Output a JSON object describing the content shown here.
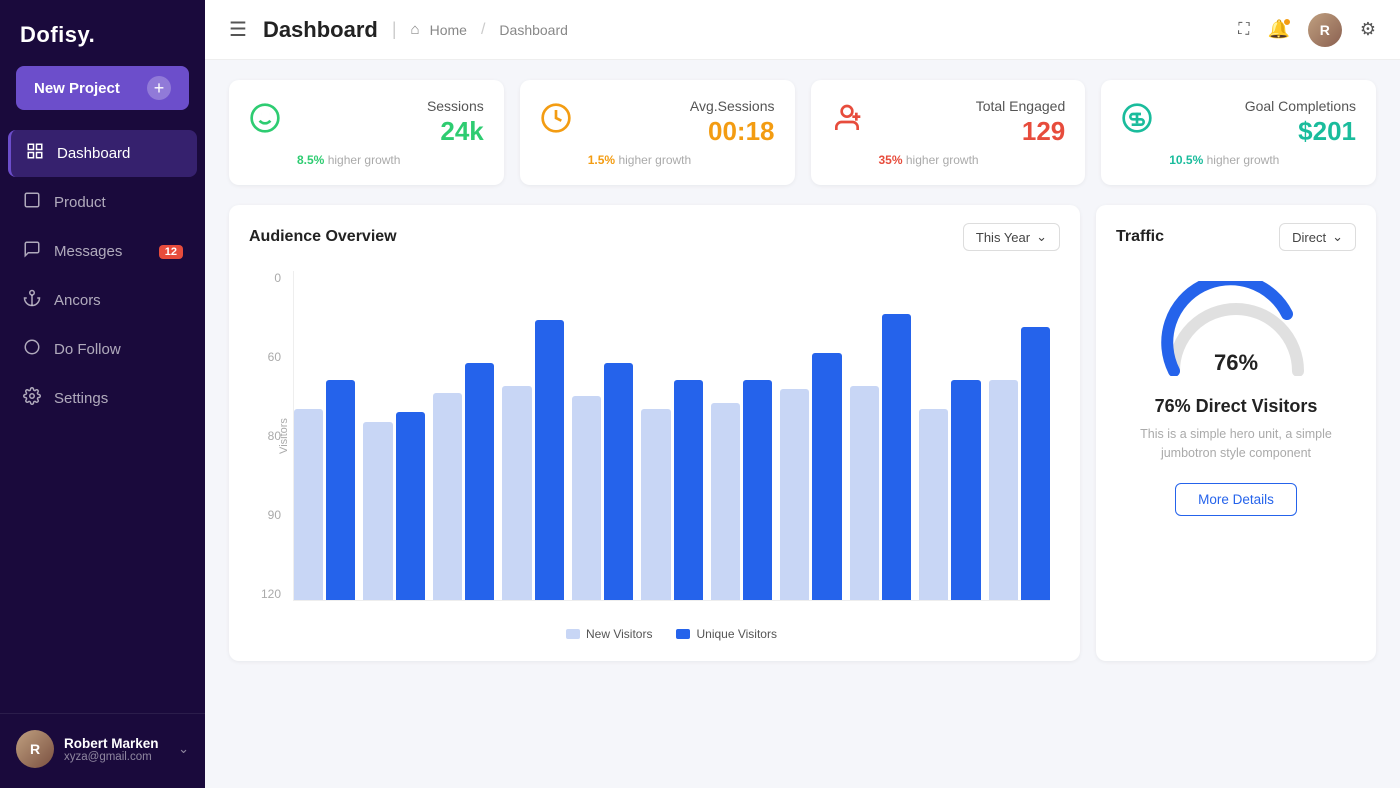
{
  "app": {
    "name": "Dofisy."
  },
  "sidebar": {
    "new_project_label": "New Project",
    "nav_items": [
      {
        "id": "dashboard",
        "label": "Dashboard",
        "icon": "grid",
        "active": true,
        "badge": null
      },
      {
        "id": "product",
        "label": "Product",
        "icon": "box",
        "active": false,
        "badge": null
      },
      {
        "id": "messages",
        "label": "Messages",
        "icon": "chat",
        "active": false,
        "badge": "12"
      },
      {
        "id": "ancors",
        "label": "Ancors",
        "icon": "anchor",
        "active": false,
        "badge": null
      },
      {
        "id": "dofollow",
        "label": "Do Follow",
        "icon": "circle",
        "active": false,
        "badge": null
      },
      {
        "id": "settings",
        "label": "Settings",
        "icon": "gear",
        "active": false,
        "badge": null
      }
    ],
    "user": {
      "name": "Robert Marken",
      "email": "xyza@gmail.com"
    }
  },
  "topbar": {
    "breadcrumb": {
      "home": "Home",
      "current": "Dashboard"
    }
  },
  "page_title": "Dashboard",
  "stats": [
    {
      "id": "sessions",
      "label": "Sessions",
      "value": "24k",
      "growth_pct": "8.5%",
      "growth_text": "higher growth",
      "color": "#2ecc71",
      "icon": "smile"
    },
    {
      "id": "avg_sessions",
      "label": "Avg.Sessions",
      "value": "00:18",
      "growth_pct": "1.5%",
      "growth_text": "higher growth",
      "color": "#f39c12",
      "icon": "clock"
    },
    {
      "id": "total_engaged",
      "label": "Total Engaged",
      "value": "129",
      "growth_pct": "35%",
      "growth_text": "higher growth",
      "color": "#e74c3c",
      "icon": "user-plus"
    },
    {
      "id": "goal_completions",
      "label": "Goal Completions",
      "value": "$201",
      "growth_pct": "10.5%",
      "growth_text": "higher growth",
      "color": "#1abc9c",
      "icon": "dollar"
    }
  ],
  "audience_overview": {
    "title": "Audience Overview",
    "filter_label": "This Year",
    "y_labels": [
      "120",
      "90",
      "80",
      "60",
      "0"
    ],
    "y_axis_label": "Visitors",
    "legend": [
      {
        "label": "New Visitors",
        "color": "#c8d6f5"
      },
      {
        "label": "Unique Visitors",
        "color": "#2563eb"
      }
    ],
    "bar_groups": [
      {
        "new_pct": 58,
        "unique_pct": 67
      },
      {
        "new_pct": 54,
        "unique_pct": 57
      },
      {
        "new_pct": 63,
        "unique_pct": 72
      },
      {
        "new_pct": 65,
        "unique_pct": 85
      },
      {
        "new_pct": 62,
        "unique_pct": 72
      },
      {
        "new_pct": 58,
        "unique_pct": 67
      },
      {
        "new_pct": 60,
        "unique_pct": 67
      },
      {
        "new_pct": 64,
        "unique_pct": 75
      },
      {
        "new_pct": 65,
        "unique_pct": 87
      },
      {
        "new_pct": 58,
        "unique_pct": 67
      },
      {
        "new_pct": 67,
        "unique_pct": 83
      }
    ]
  },
  "traffic": {
    "title": "Traffic",
    "filter_label": "Direct",
    "gauge_pct": 76,
    "gauge_label": "76%",
    "direct_label": "76% Direct Visitors",
    "description": "This is a simple hero unit, a simple jumbotron style component",
    "more_details_label": "More Details"
  }
}
